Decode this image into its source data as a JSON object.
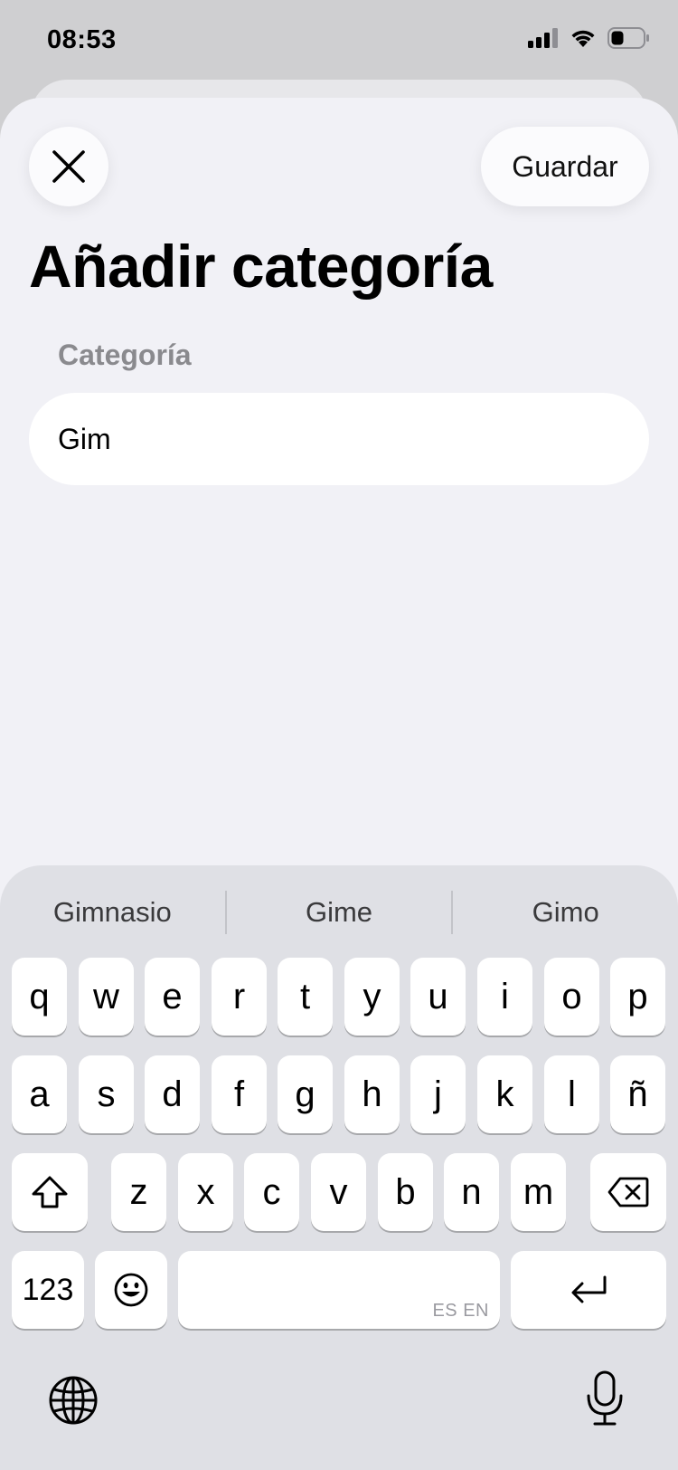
{
  "status_bar": {
    "time": "08:53"
  },
  "sheet": {
    "save_label": "Guardar",
    "title": "Añadir categoría",
    "field_label": "Categoría",
    "field_value": "Gim"
  },
  "keyboard": {
    "suggestions": [
      "Gimnasio",
      "Gime",
      "Gimo"
    ],
    "row1": [
      "q",
      "w",
      "e",
      "r",
      "t",
      "y",
      "u",
      "i",
      "o",
      "p"
    ],
    "row2": [
      "a",
      "s",
      "d",
      "f",
      "g",
      "h",
      "j",
      "k",
      "l",
      "ñ"
    ],
    "row3": [
      "z",
      "x",
      "c",
      "v",
      "b",
      "n",
      "m"
    ],
    "numbers_label": "123",
    "space_language": "ES EN"
  },
  "icons": [
    "signal-icon",
    "wifi-icon",
    "battery-icon",
    "close-icon",
    "shift-icon",
    "backspace-icon",
    "emoji-icon",
    "return-icon",
    "globe-icon",
    "microphone-icon"
  ]
}
